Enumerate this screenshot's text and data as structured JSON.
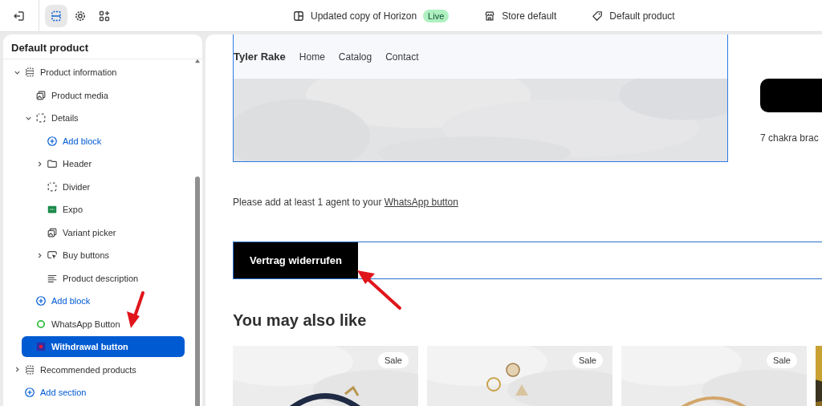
{
  "topbar": {
    "tools": [
      {
        "kind": "sections",
        "selected": true
      },
      {
        "kind": "settings",
        "selected": false
      },
      {
        "kind": "apps",
        "selected": false
      }
    ],
    "theme": {
      "name": "Updated copy of Horizon",
      "badge": "Live"
    },
    "store": "Store default",
    "template": "Default product"
  },
  "sidebar": {
    "title": "Default product",
    "tree": [
      {
        "label": "Product information",
        "kind": "section",
        "expanded": true,
        "selected": false,
        "children": [
          {
            "label": "Product media",
            "kind": "media",
            "selected": false
          },
          {
            "label": "Details",
            "kind": "group",
            "expanded": true,
            "selected": false,
            "children": [
              {
                "label": "Add block",
                "kind": "add",
                "selected": false
              },
              {
                "label": "Header",
                "kind": "folder",
                "expanded": false,
                "selected": false
              },
              {
                "label": "Divider",
                "kind": "group",
                "selected": false
              },
              {
                "label": "Expo",
                "kind": "app",
                "selected": false
              },
              {
                "label": "Variant picker",
                "kind": "media",
                "selected": false
              },
              {
                "label": "Buy buttons",
                "kind": "buy",
                "expanded": false,
                "selected": false
              },
              {
                "label": "Product description",
                "kind": "text",
                "selected": false
              }
            ]
          },
          {
            "label": "Add block",
            "kind": "add",
            "selected": false
          },
          {
            "label": "WhatsApp Button",
            "kind": "whatsapp",
            "selected": false
          },
          {
            "label": "Withdrawal button",
            "kind": "withdrawal",
            "selected": true
          }
        ]
      },
      {
        "label": "Recommended products",
        "kind": "section",
        "expanded": false,
        "selected": false
      },
      {
        "label": "Add section",
        "kind": "add",
        "selected": false
      }
    ]
  },
  "preview": {
    "nav": {
      "brand": "Tyler Rake",
      "links": [
        "Home",
        "Catalog",
        "Contact"
      ]
    },
    "side_text": "7 chakra brac",
    "notice": {
      "text": "Please add at least 1 agent to your",
      "link": "WhatsApp button"
    },
    "withdrawal_button": "Vertrag widerrufen",
    "heading": "You may also like",
    "products": [
      {
        "kind": "picture",
        "badge": "Sale"
      },
      {
        "kind": "picture",
        "badge": "Sale"
      },
      {
        "kind": "picture",
        "badge": "Sale"
      },
      {
        "kind": "picture"
      }
    ]
  }
}
